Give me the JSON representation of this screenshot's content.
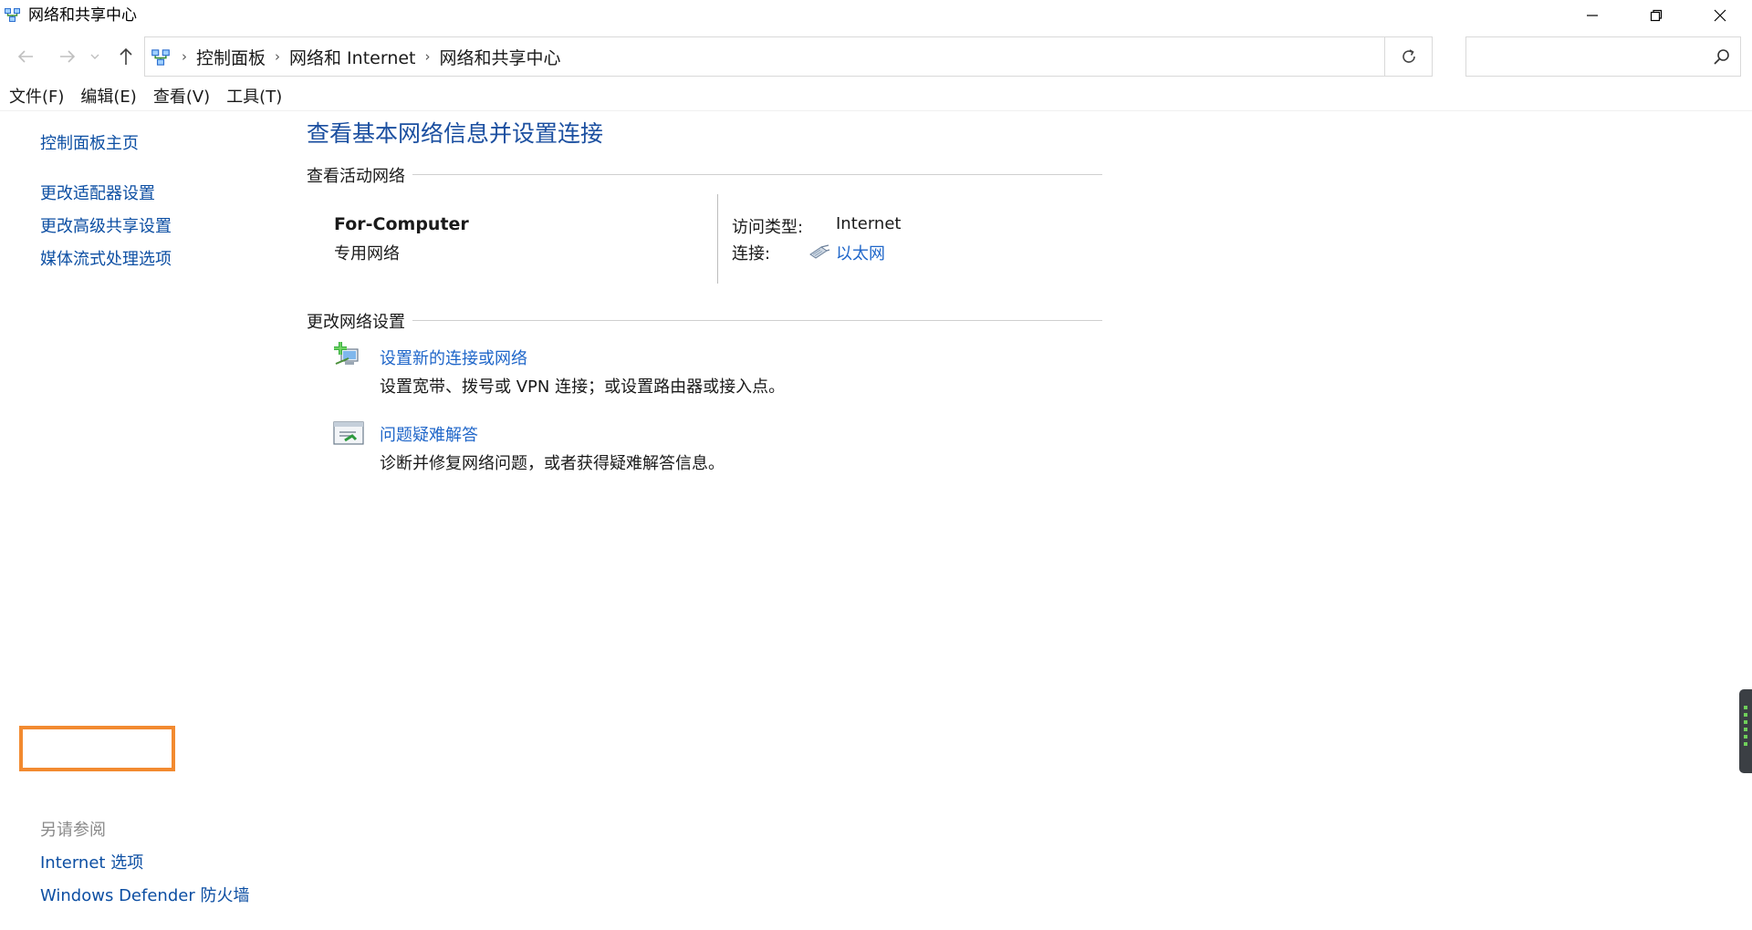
{
  "window": {
    "title": "网络和共享中心",
    "controls": {
      "minimize": "—",
      "maximize": "❐",
      "close": "✕"
    }
  },
  "address_bar": {
    "breadcrumbs": [
      "控制面板",
      "网络和 Internet",
      "网络和共享中心"
    ],
    "search_placeholder": ""
  },
  "menu": [
    "文件(F)",
    "编辑(E)",
    "查看(V)",
    "工具(T)"
  ],
  "sidebar": {
    "home": "控制面板主页",
    "links": [
      "更改适配器设置",
      "更改高级共享设置",
      "媒体流式处理选项"
    ],
    "see_also_title": "另请参阅",
    "see_also": [
      "Internet 选项",
      "Windows Defender 防火墙"
    ]
  },
  "main": {
    "title": "查看基本网络信息并设置连接",
    "active_networks_heading": "查看活动网络",
    "network": {
      "name": "For-Computer",
      "type": "专用网络",
      "access_type_label": "访问类型:",
      "access_type_value": "Internet",
      "connection_label": "连接:",
      "connection_value": "以太网"
    },
    "change_settings_heading": "更改网络设置",
    "tasks": [
      {
        "link": "设置新的连接或网络",
        "desc": "设置宽带、拨号或 VPN 连接；或设置路由器或接入点。",
        "icon": "new-connection-icon"
      },
      {
        "link": "问题疑难解答",
        "desc": "诊断并修复网络问题，或者获得疑难解答信息。",
        "icon": "troubleshoot-icon"
      }
    ]
  },
  "colors": {
    "link": "#1f66c9",
    "title": "#1b4fa0",
    "sidebar_link": "#0d4fa3",
    "highlight": "#f28a30",
    "muted": "#8a8a8a"
  }
}
